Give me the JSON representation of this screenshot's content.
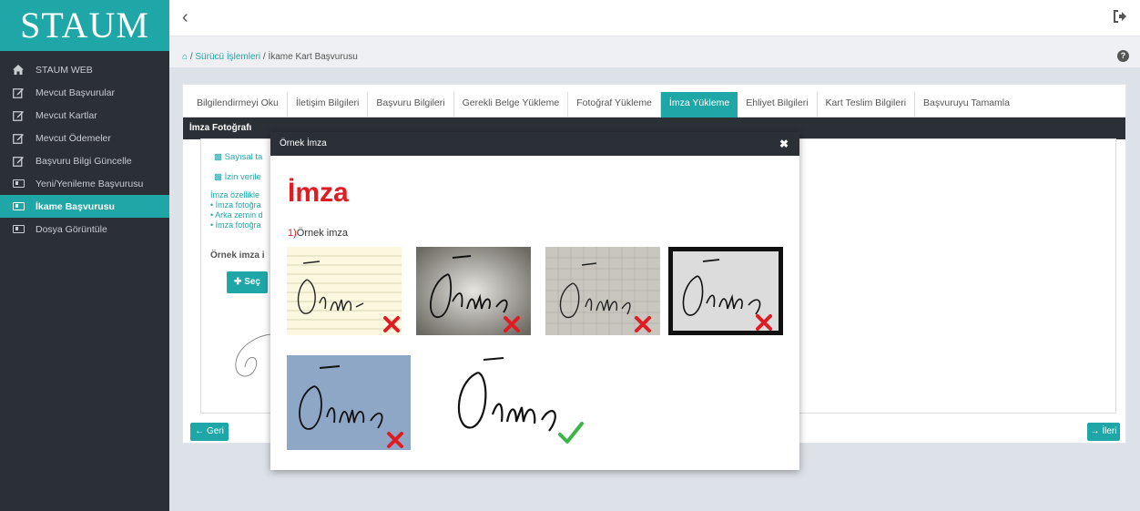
{
  "sidebar": {
    "logo": "STAUM",
    "items": [
      {
        "label": "STAUM WEB",
        "icon": "home-icon"
      },
      {
        "label": "Mevcut Başvurular",
        "icon": "edit-icon"
      },
      {
        "label": "Mevcut Kartlar",
        "icon": "edit-icon"
      },
      {
        "label": "Mevcut Ödemeler",
        "icon": "edit-icon"
      },
      {
        "label": "Başvuru Bilgi Güncelle",
        "icon": "edit-icon"
      },
      {
        "label": "Yeni/Yenileme Başvurusu",
        "icon": "id-card-icon"
      },
      {
        "label": "İkame Başvurusu",
        "icon": "id-card-icon"
      },
      {
        "label": "Dosya Görüntüle",
        "icon": "id-card-icon"
      }
    ]
  },
  "breadcrumb": {
    "parent": "Sürücü İşlemleri",
    "current": "İkame Kart Başvurusu"
  },
  "tabs": [
    "Bilgilendirmeyi Oku",
    "İletişim Bilgileri",
    "Başvuru Bilgileri",
    "Gerekli Belge Yükleme",
    "Fotoğraf Yükleme",
    "İmza Yükleme",
    "Ehliyet Bilgileri",
    "Kart Teslim Bilgileri",
    "Başvuruyu Tamamla"
  ],
  "section": {
    "title": "İmza Fotoğrafı",
    "line1": "Sayısal ta",
    "line2": "İzin verile",
    "features_title": "İmza özellikle",
    "bullet1": "• İmza fotoğra",
    "bullet2": "• Arka zemin d",
    "bullet3": "• İmza fotoğra",
    "sample_label": "Örnek imza i",
    "select_button": "Seç"
  },
  "nav": {
    "back": "Geri",
    "next": "İleri"
  },
  "modal": {
    "header": "Örnek İmza",
    "title": "İmza",
    "sub_number": "1)",
    "sub_text": "Örnek imza"
  },
  "colors": {
    "accent": "#1fa7a7",
    "dark": "#2b2f36",
    "error": "#e11b22",
    "success": "#3bb54a"
  }
}
